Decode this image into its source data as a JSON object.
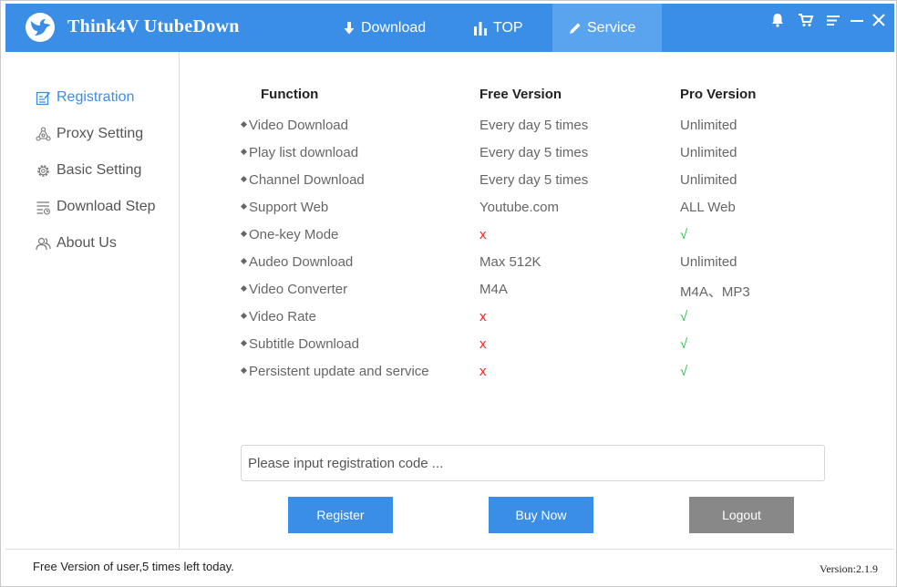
{
  "app": {
    "title": "Think4V  UtubeDown"
  },
  "nav": [
    {
      "label": "Download",
      "icon": "download-arrow-icon"
    },
    {
      "label": "TOP",
      "icon": "bar-chart-icon"
    },
    {
      "label": "Service",
      "icon": "pencil-icon",
      "active": true
    }
  ],
  "sidebar": {
    "items": [
      {
        "label": "Registration",
        "icon": "edit-note-icon",
        "active": true
      },
      {
        "label": "Proxy Setting",
        "icon": "proxy-network-icon"
      },
      {
        "label": "Basic Setting",
        "icon": "gear-icon"
      },
      {
        "label": "Download Step",
        "icon": "list-icon"
      },
      {
        "label": "About Us",
        "icon": "people-icon"
      }
    ]
  },
  "table": {
    "headers": [
      "Function",
      "Free Version",
      "Pro Version"
    ],
    "rows": [
      {
        "func": "Video Download",
        "free": "Every day 5 times",
        "pro": "Unlimited"
      },
      {
        "func": "Play list download",
        "free": "Every day 5 times",
        "pro": "Unlimited"
      },
      {
        "func": "Channel Download",
        "free": "Every day 5 times",
        "pro": "Unlimited"
      },
      {
        "func": "Support Web",
        "free": "Youtube.com",
        "pro": "ALL Web"
      },
      {
        "func": "One-key Mode",
        "free": "x",
        "pro": "√"
      },
      {
        "func": "Audeo Download",
        "free": "Max 512K",
        "pro": "Unlimited"
      },
      {
        "func": "Video Converter",
        "free": "M4A",
        "pro": "M4A、MP3"
      },
      {
        "func": "Video Rate",
        "free": "x",
        "pro": "√"
      },
      {
        "func": "Subtitle Download",
        "free": "x",
        "pro": "√"
      },
      {
        "func": "Persistent update and service",
        "free": "x",
        "pro": "√"
      }
    ]
  },
  "registration": {
    "placeholder": "Please input registration code ...",
    "value": ""
  },
  "buttons": {
    "register": "Register",
    "buy_now": "Buy Now",
    "logout": "Logout"
  },
  "status": {
    "text": "Free Version of user,5 times left today.",
    "version": "Version:2.1.9"
  },
  "colors": {
    "brand": "#3a8ee6",
    "nav_active": "#5aa4ef",
    "cross": "#e8271d",
    "check": "#2ec24b",
    "logout_button": "#888888"
  }
}
